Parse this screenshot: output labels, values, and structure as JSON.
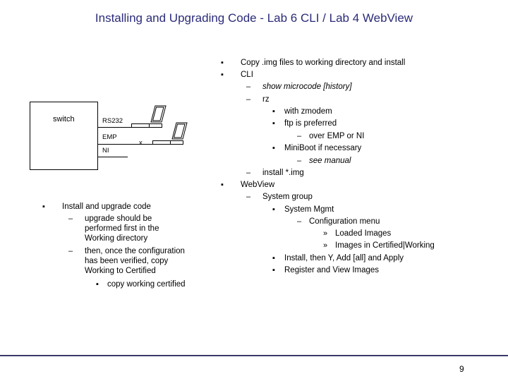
{
  "title": "Installing and Upgrading Code - Lab 6 CLI / Lab 4 WebView",
  "diagram": {
    "box_label": "switch",
    "ports": [
      "RS232",
      "EMP",
      "NI"
    ],
    "break_mark": "x"
  },
  "left_list": {
    "bullet": "Install and upgrade code",
    "sub1": [
      "upgrade should be",
      "performed first in the",
      "Working directory"
    ],
    "sub2": [
      "then, once the configuration",
      "has been verified, copy",
      "Working to Certified"
    ],
    "sub2_bullet": "copy working certified"
  },
  "right_list": {
    "items": [
      "Copy .img files to working directory and install",
      "CLI",
      "show microcode [history]",
      "rz",
      "with zmodem",
      "ftp is preferred",
      "over EMP or NI",
      "MiniBoot if necessary",
      "see manual",
      "install *.img",
      "WebView",
      "System group",
      "System Mgmt",
      "Configuration menu",
      "Loaded Images",
      "Images in Certified|Working",
      "Install, then Y, Add [all] and Apply",
      "Register and View Images"
    ]
  },
  "markers": {
    "bullet": "▪",
    "dash": "–",
    "raquo": "»"
  },
  "page_number": "9"
}
